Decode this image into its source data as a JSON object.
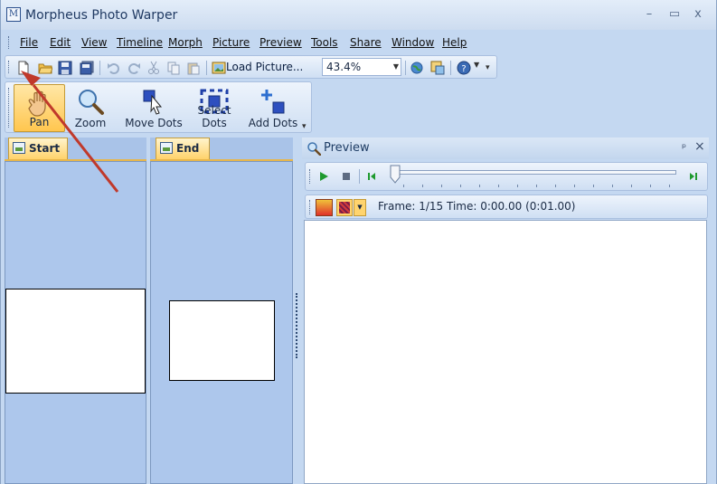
{
  "window": {
    "title": "Morpheus Photo Warper",
    "controls": {
      "minimize": "–",
      "maximize": "▭",
      "close": "x"
    }
  },
  "menu": {
    "items": [
      "File",
      "Edit",
      "View",
      "Timeline",
      "Morph",
      "Picture",
      "Preview",
      "Tools",
      "Share",
      "Window",
      "Help"
    ]
  },
  "toolbar": {
    "load_picture_label": "Load Picture...",
    "zoom_value": "43.4%"
  },
  "tools": {
    "pan": "Pan",
    "zoom": "Zoom",
    "move_dots": "Move Dots",
    "select_dots": "Select Dots",
    "add_dots": "Add Dots"
  },
  "panels": {
    "start_tab": "Start",
    "end_tab": "End"
  },
  "preview": {
    "title": "Preview",
    "pin": "ᵖ",
    "close": "×",
    "frame_info": "Frame: 1/15 Time: 0:00.00 (0:01.00)"
  },
  "colors": {
    "window_bg": "#c4d8f1",
    "panel_bg": "#adc7ec",
    "tab_active": "#ffd26b",
    "annotation_arrow": "#c0392b"
  }
}
